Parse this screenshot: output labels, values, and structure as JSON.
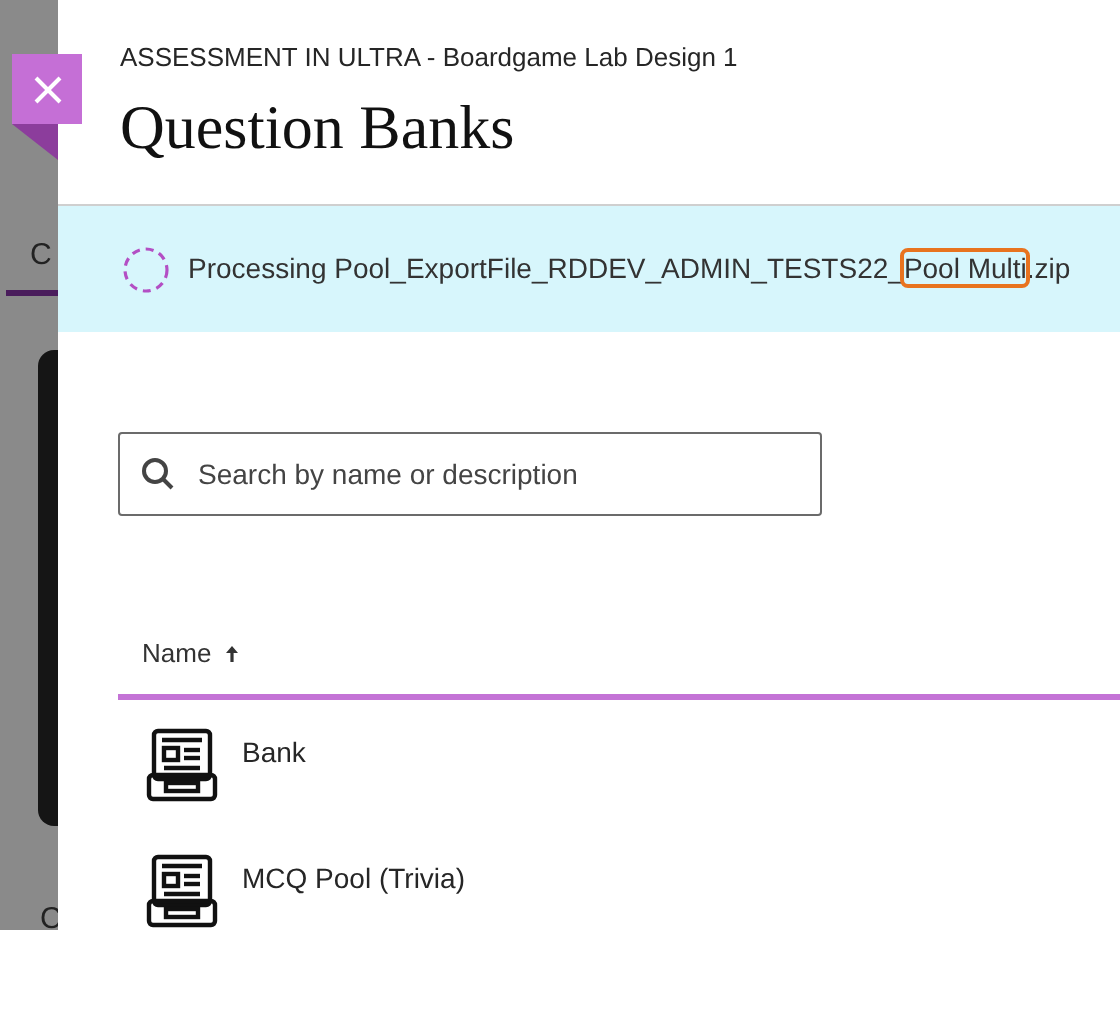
{
  "background_page": {
    "tab_label": "C",
    "footer_label": "C"
  },
  "panel": {
    "breadcrumb": "ASSESSMENT IN ULTRA - Boardgame Lab Design 1",
    "title": "Question Banks",
    "banner": {
      "text_before": "Processing Pool_ExportFile_RDDEV_ADMIN_TESTS22_",
      "highlighted": "Pool Multi",
      "text_after": ".zip"
    },
    "search": {
      "placeholder": "Search by name or description"
    },
    "table": {
      "columns": [
        {
          "label": "Name"
        }
      ],
      "rows": [
        {
          "name": "Bank"
        },
        {
          "name": "MCQ Pool (Trivia)"
        }
      ]
    }
  }
}
